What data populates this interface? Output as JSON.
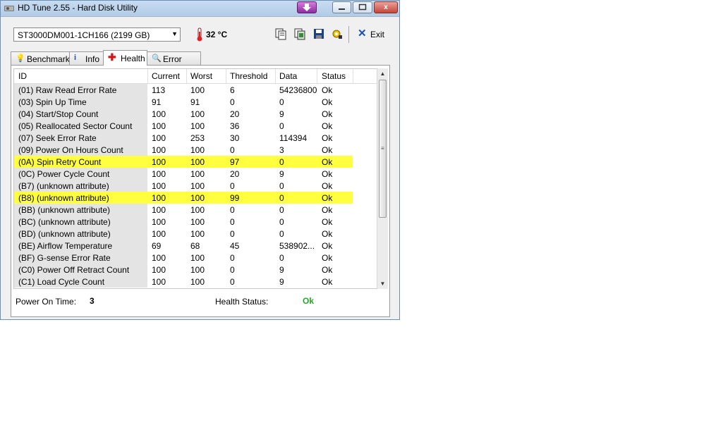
{
  "window": {
    "title": "HD Tune 2.55 - Hard Disk Utility",
    "buttons": {
      "close": "x"
    }
  },
  "toolbar": {
    "drive": "ST3000DM001-1CH166 (2199 GB)",
    "temperature": "32 °C",
    "exit_label": "Exit",
    "icons": [
      "copy-text-icon",
      "copy-screenshot-icon",
      "save-icon",
      "options-icon"
    ]
  },
  "tabs": [
    {
      "label": "Benchmark",
      "icon": "benchmark-icon"
    },
    {
      "label": "Info",
      "icon": "info-icon"
    },
    {
      "label": "Health",
      "icon": "health-cross-icon",
      "active": true
    },
    {
      "label": "Error Scan",
      "icon": "magnifier-icon"
    }
  ],
  "table": {
    "columns": [
      "ID",
      "Current",
      "Worst",
      "Threshold",
      "Data",
      "Status"
    ],
    "rows": [
      {
        "id": "(01) Raw Read Error Rate",
        "current": "113",
        "worst": "100",
        "threshold": "6",
        "data": "54236800",
        "status": "Ok",
        "warn": false
      },
      {
        "id": "(03) Spin Up Time",
        "current": "91",
        "worst": "91",
        "threshold": "0",
        "data": "0",
        "status": "Ok",
        "warn": false
      },
      {
        "id": "(04) Start/Stop Count",
        "current": "100",
        "worst": "100",
        "threshold": "20",
        "data": "9",
        "status": "Ok",
        "warn": false
      },
      {
        "id": "(05) Reallocated Sector Count",
        "current": "100",
        "worst": "100",
        "threshold": "36",
        "data": "0",
        "status": "Ok",
        "warn": false
      },
      {
        "id": "(07) Seek Error Rate",
        "current": "100",
        "worst": "253",
        "threshold": "30",
        "data": "114394",
        "status": "Ok",
        "warn": false
      },
      {
        "id": "(09) Power On Hours Count",
        "current": "100",
        "worst": "100",
        "threshold": "0",
        "data": "3",
        "status": "Ok",
        "warn": false
      },
      {
        "id": "(0A) Spin Retry Count",
        "current": "100",
        "worst": "100",
        "threshold": "97",
        "data": "0",
        "status": "Ok",
        "warn": true
      },
      {
        "id": "(0C) Power Cycle Count",
        "current": "100",
        "worst": "100",
        "threshold": "20",
        "data": "9",
        "status": "Ok",
        "warn": false
      },
      {
        "id": "(B7) (unknown attribute)",
        "current": "100",
        "worst": "100",
        "threshold": "0",
        "data": "0",
        "status": "Ok",
        "warn": false
      },
      {
        "id": "(B8) (unknown attribute)",
        "current": "100",
        "worst": "100",
        "threshold": "99",
        "data": "0",
        "status": "Ok",
        "warn": true
      },
      {
        "id": "(BB) (unknown attribute)",
        "current": "100",
        "worst": "100",
        "threshold": "0",
        "data": "0",
        "status": "Ok",
        "warn": false
      },
      {
        "id": "(BC) (unknown attribute)",
        "current": "100",
        "worst": "100",
        "threshold": "0",
        "data": "0",
        "status": "Ok",
        "warn": false
      },
      {
        "id": "(BD) (unknown attribute)",
        "current": "100",
        "worst": "100",
        "threshold": "0",
        "data": "0",
        "status": "Ok",
        "warn": false
      },
      {
        "id": "(BE) Airflow Temperature",
        "current": "69",
        "worst": "68",
        "threshold": "45",
        "data": "538902...",
        "status": "Ok",
        "warn": false
      },
      {
        "id": "(BF) G-sense Error Rate",
        "current": "100",
        "worst": "100",
        "threshold": "0",
        "data": "0",
        "status": "Ok",
        "warn": false
      },
      {
        "id": "(C0) Power Off Retract Count",
        "current": "100",
        "worst": "100",
        "threshold": "0",
        "data": "9",
        "status": "Ok",
        "warn": false
      },
      {
        "id": "(C1) Load Cycle Count",
        "current": "100",
        "worst": "100",
        "threshold": "0",
        "data": "9",
        "status": "Ok",
        "warn": false
      }
    ]
  },
  "footer": {
    "power_on_label": "Power On Time:",
    "power_on_value": "3",
    "health_label": "Health Status:",
    "health_value": "Ok"
  },
  "colors": {
    "warn_row": "#ffff40",
    "ok_green": "#22aa22"
  }
}
